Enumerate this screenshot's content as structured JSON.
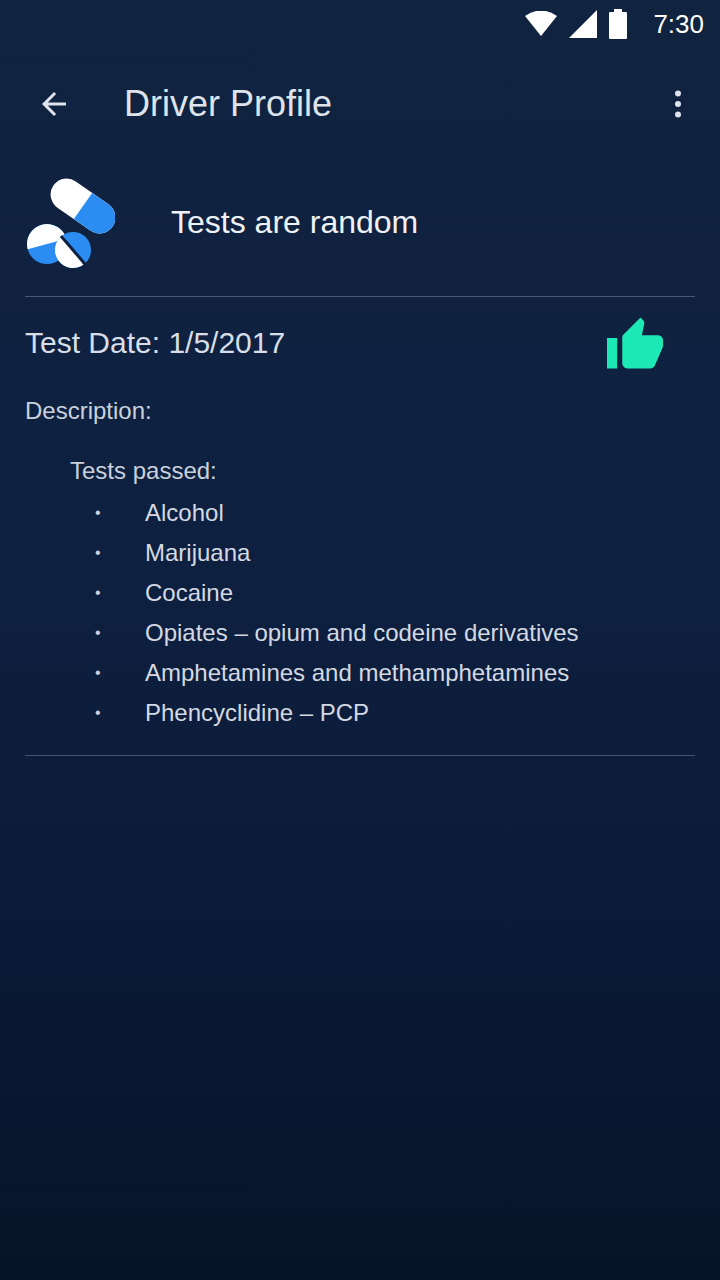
{
  "status_bar": {
    "time": "7:30"
  },
  "app_bar": {
    "title": "Driver Profile"
  },
  "header": {
    "text": "Tests are random"
  },
  "test": {
    "date_label": "Test Date: 1/5/2017",
    "passed": true,
    "description_label": "Description:",
    "list_title": "Tests passed:",
    "items": [
      "Alcohol",
      "Marijuana",
      "Cocaine",
      "Opiates – opium and codeine derivatives",
      "Amphetamines and methamphetamines",
      "Phencyclidine – PCP"
    ]
  }
}
